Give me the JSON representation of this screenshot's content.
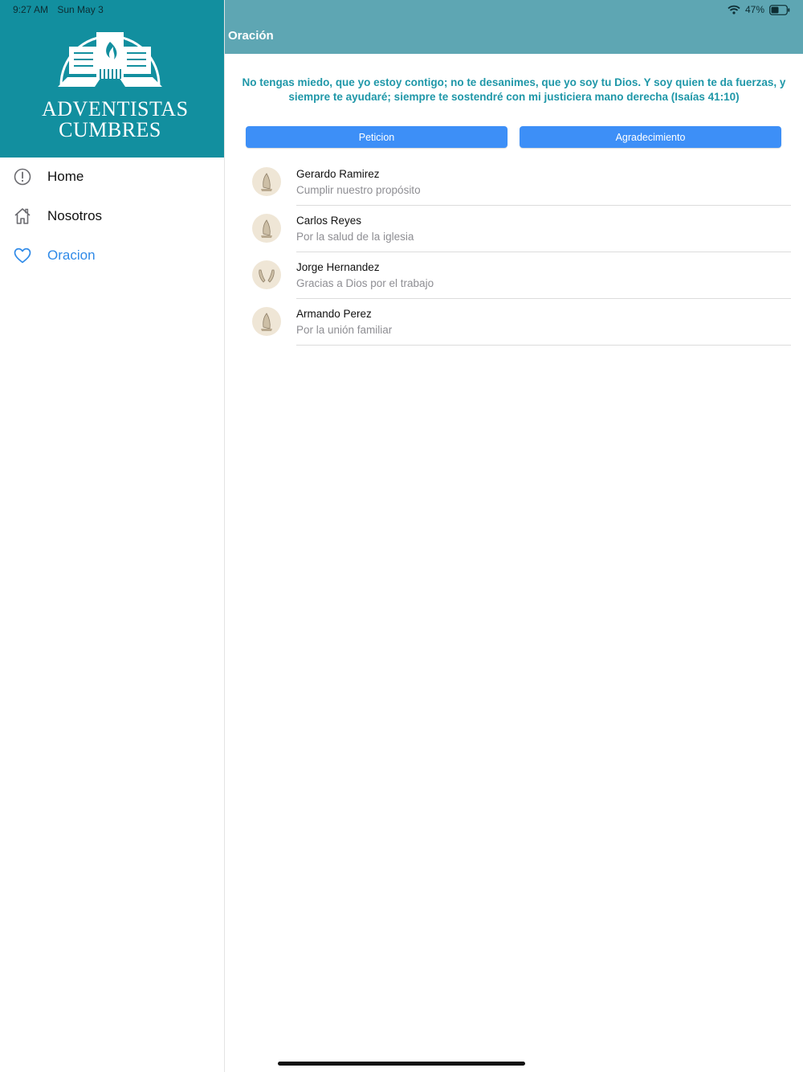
{
  "status_bar": {
    "time": "9:27 AM",
    "date": "Sun May 3",
    "battery": "47%"
  },
  "sidebar": {
    "logo_line1": "ADVENTISTAS",
    "logo_line2": "CUMBRES",
    "header_color": "#128f9f",
    "items": [
      {
        "label": "Home",
        "icon": "info-circle-icon",
        "active": false
      },
      {
        "label": "Nosotros",
        "icon": "house-icon",
        "active": false
      },
      {
        "label": "Oracion",
        "icon": "heart-icon",
        "active": true
      }
    ]
  },
  "main": {
    "title": "Oración",
    "verse": "No tengas miedo, que yo estoy contigo; no te desanimes, que yo soy tu Dios. Y soy quien te da fuerzas, y siempre te ayudaré; siempre te sostendré con mi justiciera mano derecha (Isaías 41:10)",
    "buttons": {
      "peticion": "Peticion",
      "agradecimiento": "Agradecimiento"
    },
    "accent_color": "#3d8ff7",
    "requests": [
      {
        "name": "Gerardo Ramirez",
        "message": "Cumplir nuestro propósito",
        "icon": "praying-hands-icon"
      },
      {
        "name": "Carlos Reyes",
        "message": "Por la salud de la iglesia",
        "icon": "praying-hands-icon"
      },
      {
        "name": "Jorge Hernandez",
        "message": "Gracias a Dios por el trabajo",
        "icon": "raised-hands-icon"
      },
      {
        "name": "Armando Perez",
        "message": "Por la unión familiar",
        "icon": "praying-hands-icon"
      }
    ]
  }
}
